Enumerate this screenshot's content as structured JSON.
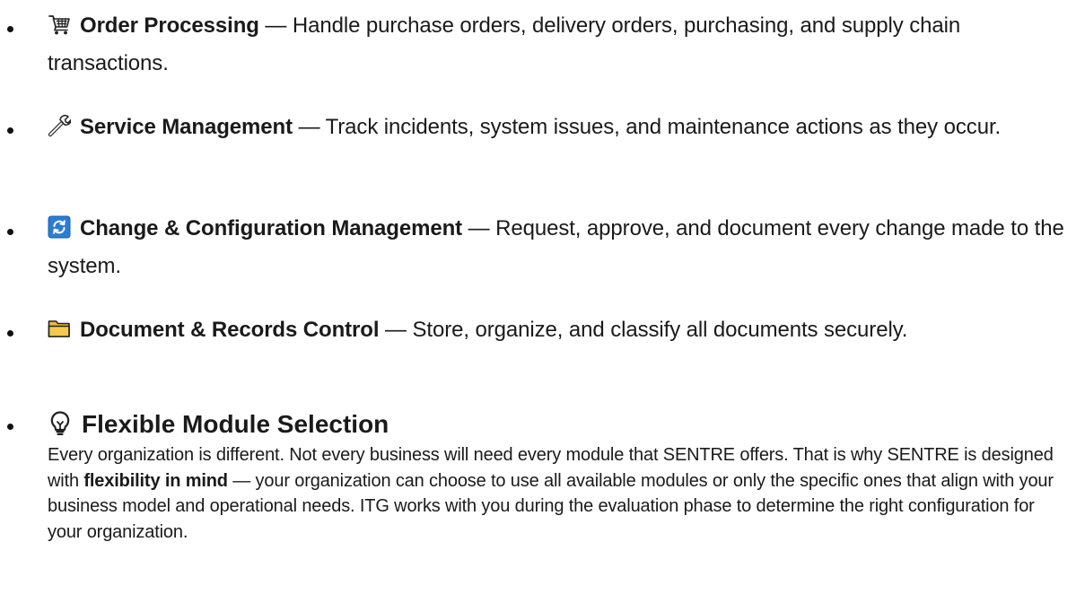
{
  "items": [
    {
      "icon": "shopping-cart-icon",
      "title": "Order Processing",
      "separator": "—",
      "description": "Handle purchase orders, delivery orders, purchasing, and supply chain transactions."
    },
    {
      "icon": "wrench-icon",
      "title": "Service Management",
      "separator": "—",
      "description": "Track incidents, system issues, and maintenance actions as they occur."
    },
    {
      "icon": "refresh-arrows-icon",
      "title": "Change & Configuration Management",
      "separator": "—",
      "description": "Request, approve, and document every change made to the system."
    },
    {
      "icon": "folder-icon",
      "title": "Document & Records Control",
      "separator": "—",
      "description": "Store, organize, and classify all documents securely."
    }
  ],
  "flexible": {
    "icon": "lightbulb-icon",
    "heading": "Flexible Module Selection",
    "para_part1": "Every organization is different. Not every business will need every module that SENTRE offers. That is why SENTRE is designed with ",
    "para_bold": "flexibility in mind",
    "para_part2": " — your organization can choose to use all available modules or only the specific ones that align with your business model and operational needs. ITG works with you during the evaluation phase to determine the right configuration for your organization."
  },
  "colors": {
    "text": "#1a1a1a",
    "icon_blue": "#2b7cd3",
    "folder_yellow": "#f7c948"
  }
}
